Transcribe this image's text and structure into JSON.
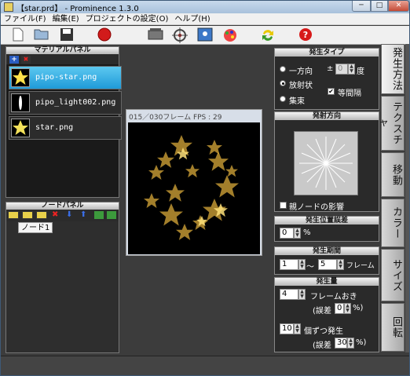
{
  "window": {
    "title": "【star.prd】 - Prominence 1.3.0",
    "minimize": "─",
    "maximize": "□",
    "close": "✕"
  },
  "menu": [
    "ファイル(F)",
    "編集(E)",
    "プロジェクトの設定(O)",
    "ヘルプ(H)"
  ],
  "material_panel": {
    "title": "マテリアルパネル",
    "add_icon": "+",
    "delete_icon": "✖",
    "items": [
      {
        "label": "pipo-star.png",
        "selected": true
      },
      {
        "label": "pipo_light002.png",
        "selected": false
      },
      {
        "label": "star.png",
        "selected": false
      }
    ]
  },
  "node_panel": {
    "title": "ノードパネル",
    "node": "ノード1"
  },
  "preview": {
    "header": "015／030フレーム  FPS : 29"
  },
  "gen_type": {
    "title": "発生タイプ",
    "one_direction": "一方向",
    "radial": "放射状",
    "focus": "集束",
    "pm": "±",
    "angle_value": "0",
    "angle_unit": "度",
    "equal_interval": "等間隔",
    "selected": "radial"
  },
  "emit_dir": {
    "title": "発射方向",
    "parent_influence": "親ノードの影響"
  },
  "pos_error": {
    "title": "発生位置誤差",
    "value": "0",
    "unit": "%"
  },
  "period": {
    "title": "発生期間",
    "from": "1",
    "tilde": "～",
    "to": "5",
    "unit": "フレーム"
  },
  "amount": {
    "title": "発生量",
    "frame_value": "4",
    "frame_label": "フレームおき",
    "err_label": "(誤差",
    "err1": "0",
    "err_unit": "%)",
    "count_value": "10",
    "count_label": "個ずつ発生",
    "err2": "30"
  },
  "tabs": [
    "発生方法",
    "テクスチャ",
    "移動",
    "カラー",
    "サイズ",
    "回転"
  ]
}
